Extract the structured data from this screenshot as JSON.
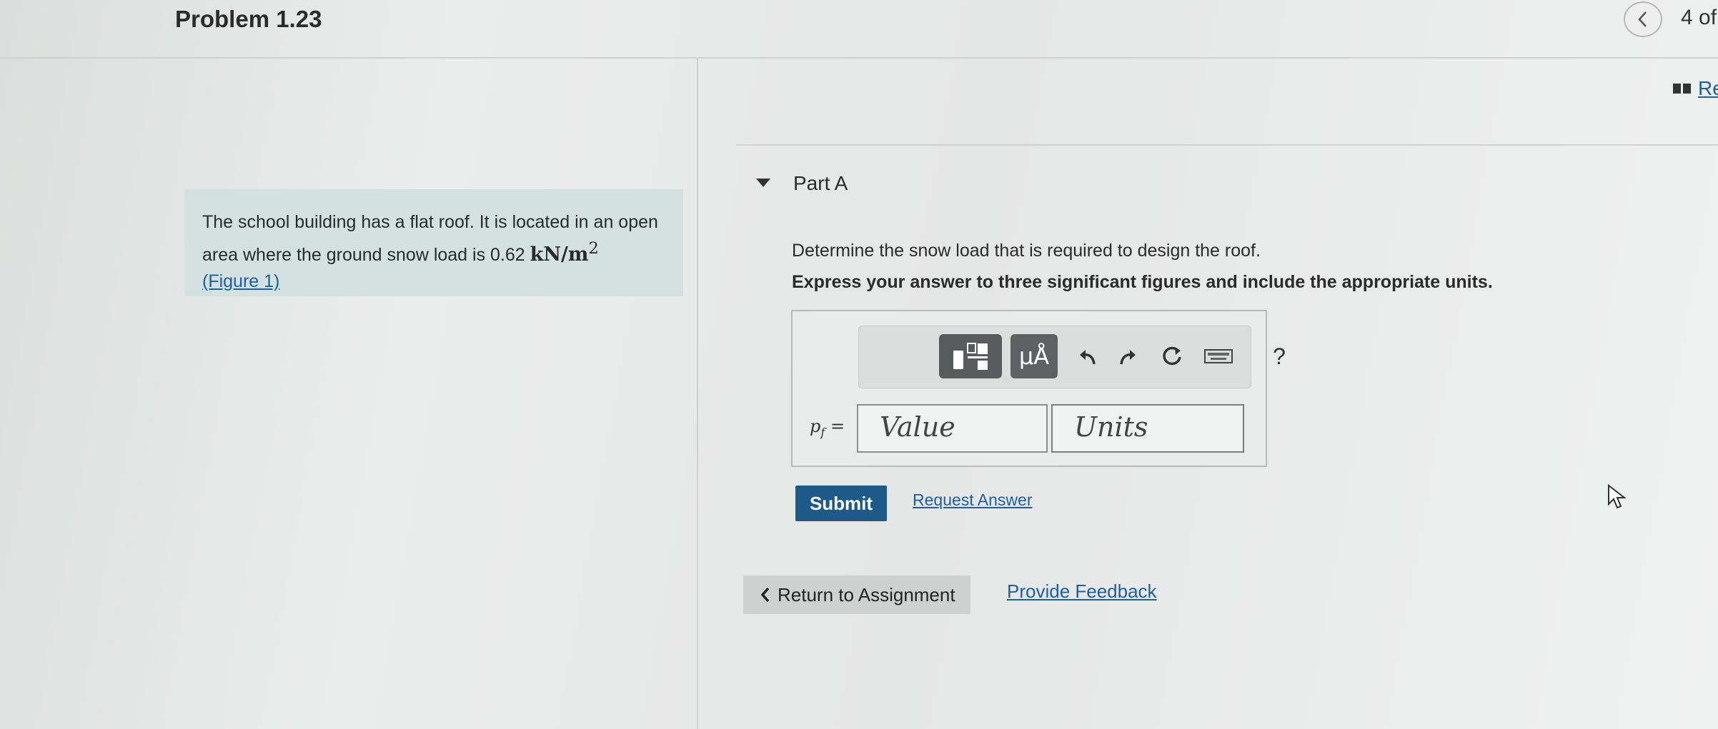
{
  "header": {
    "problem_title": "Problem 1.23",
    "pager_text": "4 of",
    "review_label": "Re"
  },
  "problem": {
    "text_line1": "The school building has a flat roof. It is located in an open",
    "text_line2_prefix": "area where the ground snow load is 0.62 ",
    "load_unit": "kN/m",
    "load_exponent": "2",
    "figure_link": "(Figure 1)"
  },
  "part": {
    "label": "Part A",
    "question": "Determine the snow load that is required to design the roof.",
    "instruction": "Express your answer to three significant figures and include the appropriate units."
  },
  "answer": {
    "variable": "p",
    "variable_sub": "f",
    "equals": "=",
    "value_placeholder": "Value",
    "units_placeholder": "Units",
    "toolbar": {
      "units_label": "μÅ",
      "help_label": "?"
    }
  },
  "actions": {
    "submit_label": "Submit",
    "request_answer_label": "Request Answer",
    "return_label": "Return to Assignment",
    "feedback_label": "Provide Feedback"
  },
  "colors": {
    "accent": "#1d5a8a",
    "link": "#1f5fa0",
    "problem_box_bg": "#d3e2e0"
  }
}
